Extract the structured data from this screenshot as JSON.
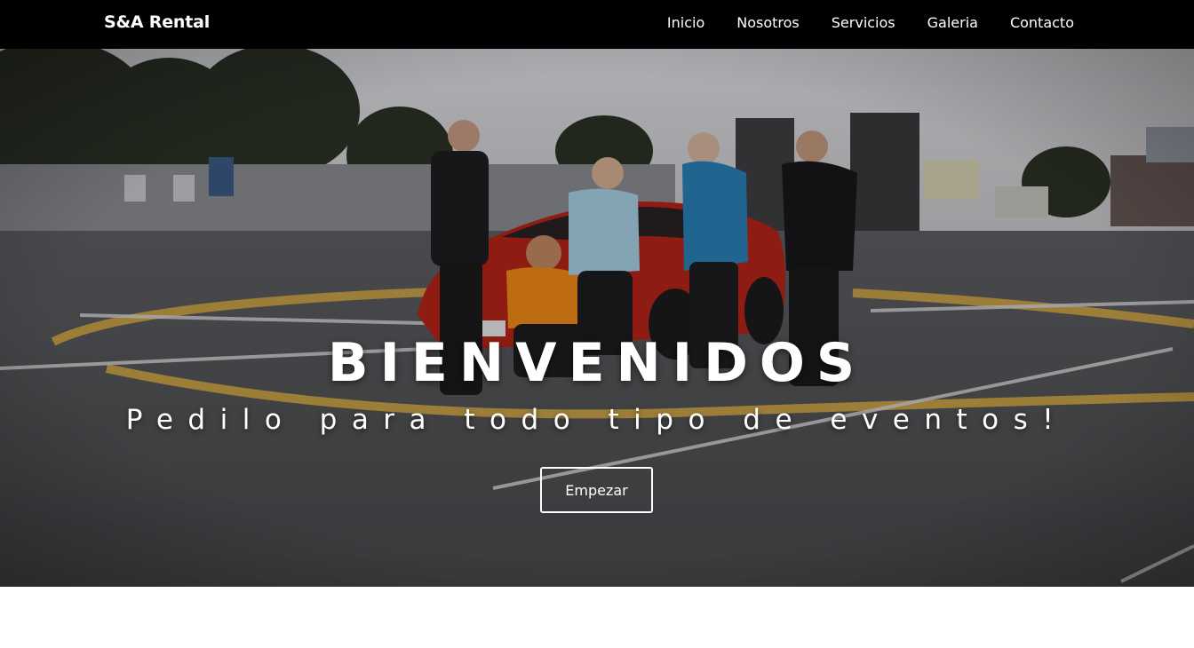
{
  "nav": {
    "brand": "S&A Rental",
    "links": [
      "Inicio",
      "Nosotros",
      "Servicios",
      "Galeria",
      "Contacto"
    ]
  },
  "hero": {
    "title": "BIENVENIDOS",
    "subtitle": "Pedilo para todo tipo de eventos!",
    "cta_label": "Empezar"
  },
  "colors": {
    "navbar_bg": "#000000",
    "text": "#ffffff",
    "car": "#c4281c",
    "lot_lines": "#c9a24a"
  }
}
